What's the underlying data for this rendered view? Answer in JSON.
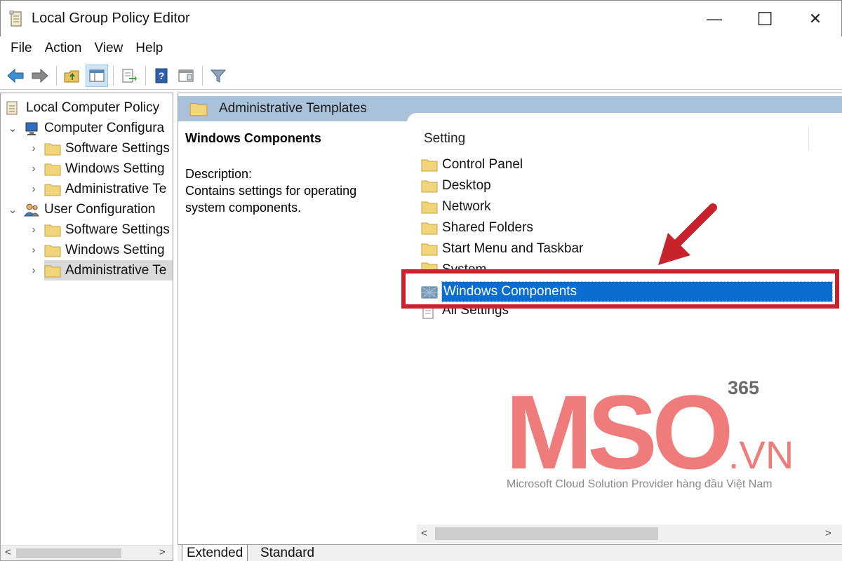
{
  "window": {
    "title": "Local Group Policy Editor",
    "minimize_glyph": "—",
    "maximize_glyph": "☐",
    "close_glyph": "✕"
  },
  "menu": [
    "File",
    "Action",
    "View",
    "Help"
  ],
  "toolbar": {
    "buttons": [
      "back-arrow-icon",
      "forward-arrow-icon",
      "up-folder-icon",
      "show-hide-tree-icon",
      "export-list-icon",
      "help-icon",
      "properties-view-icon",
      "filter-icon"
    ]
  },
  "tree": {
    "root": "Local Computer Policy",
    "items": [
      {
        "label": "Computer Configura",
        "expanded": true
      },
      {
        "label": "Software Settings"
      },
      {
        "label": "Windows Setting"
      },
      {
        "label": "Administrative Te"
      },
      {
        "label": "User Configuration",
        "expanded": true
      },
      {
        "label": "Software Settings"
      },
      {
        "label": "Windows Setting"
      },
      {
        "label": "Administrative Te",
        "selected": true
      }
    ],
    "scroll_left": "<",
    "scroll_right": ">"
  },
  "header": {
    "title": "Administrative Templates"
  },
  "description": {
    "title": "Windows Components",
    "label": "Description:",
    "text_line1": "Contains settings for operating",
    "text_line2": "system components."
  },
  "list": {
    "column_header": "Setting",
    "rows": [
      "Control Panel",
      "Desktop",
      "Network",
      "Shared Folders",
      "Start Menu and Taskbar",
      "System",
      "Windows Components",
      "All Settings"
    ],
    "selected_index": 6,
    "scroll_left": "<",
    "scroll_right": ">"
  },
  "tabs": [
    "Extended",
    "Standard"
  ],
  "watermark": {
    "logo_text": "MSO",
    "suffix": ".VN",
    "badge": "365",
    "tagline": "Microsoft Cloud Solution Provider hàng đầu Việt Nam"
  },
  "colors": {
    "selection": "#0a6ed1",
    "header_band": "#a9c2d9",
    "highlight_box": "#c8232c",
    "arrow": "#c8232c",
    "watermark_pink": "#ef7b7b"
  }
}
